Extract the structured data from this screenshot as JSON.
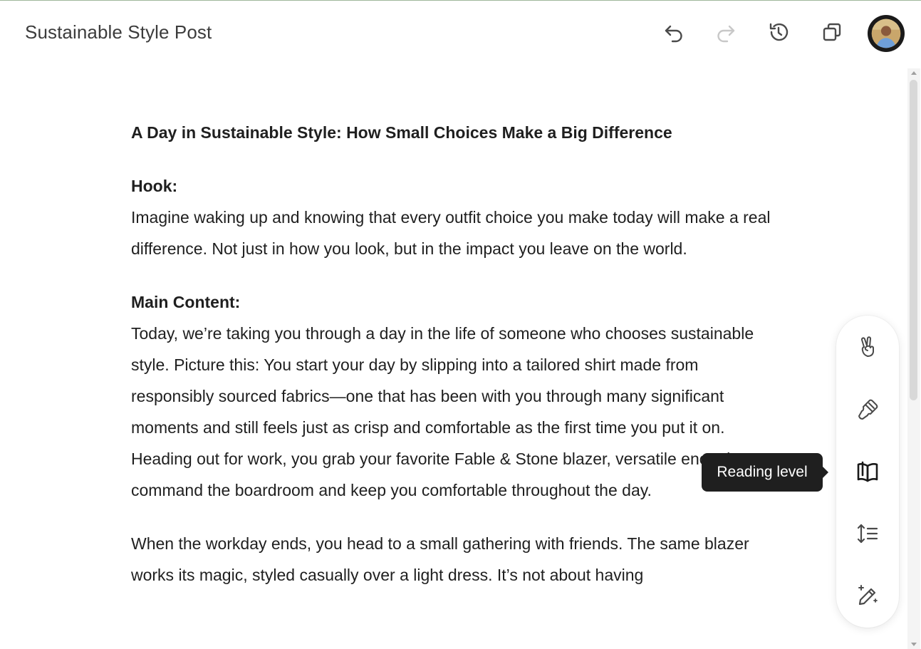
{
  "app": {
    "doc_title": "Sustainable Style Post"
  },
  "toolbar": {
    "undo_icon": "undo-icon",
    "redo_icon": "redo-icon",
    "history_icon": "history-icon",
    "copy_icon": "copy-icon",
    "avatar_icon": "user-avatar"
  },
  "document": {
    "title": "A Day in Sustainable Style: How Small Choices Make a Big Difference",
    "sections": [
      {
        "heading": "Hook:",
        "text": "Imagine waking up and knowing that every outfit choice you make today will make a real difference. Not just in how you look, but in the impact you leave on the world."
      },
      {
        "heading": "Main Content:",
        "text": "Today, we’re taking you through a day in the life of someone who chooses sustainable style. Picture this: You start your day by slipping into a tailored shirt made from responsibly sourced fabrics—one that has been with you through many significant moments and still feels just as crisp and comfortable as the first time you put it on. Heading out for work, you grab your favorite Fable & Stone blazer, versatile enough to command the boardroom and keep you comfortable throughout the day."
      },
      {
        "heading": "",
        "text": "When the workday ends, you head to a small gathering with friends. The same blazer works its magic, styled casually over a light dress. It’s not about having"
      }
    ]
  },
  "tools": {
    "items": [
      {
        "name": "emoji-tool",
        "icon": "peace-hand-icon"
      },
      {
        "name": "polish-tool",
        "icon": "brush-icon"
      },
      {
        "name": "reading-level-tool",
        "icon": "book-icon"
      },
      {
        "name": "length-tool",
        "icon": "adjust-length-icon"
      },
      {
        "name": "suggest-edits-tool",
        "icon": "magic-pencil-icon"
      }
    ],
    "tooltip": "Reading level"
  },
  "colors": {
    "accent_line": "#9fb79a",
    "tooltip_bg": "#1f1f1f",
    "icon": "#4a4a4a",
    "icon_disabled": "#c8c8c8"
  }
}
